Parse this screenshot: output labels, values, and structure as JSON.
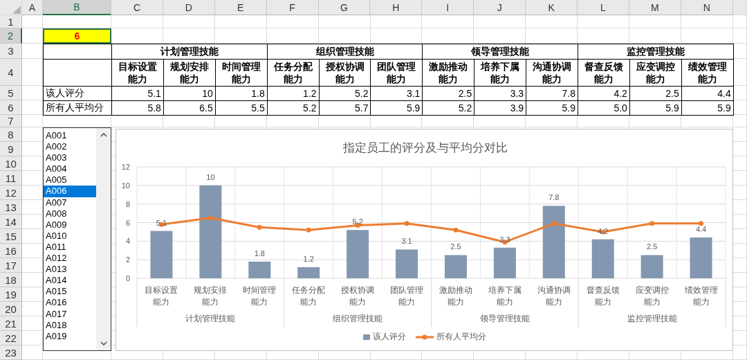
{
  "column_headers": [
    {
      "label": "A",
      "selected": false
    },
    {
      "label": "B",
      "selected": true
    },
    {
      "label": "C",
      "selected": false
    },
    {
      "label": "D",
      "selected": false
    },
    {
      "label": "E",
      "selected": false
    },
    {
      "label": "F",
      "selected": false
    },
    {
      "label": "G",
      "selected": false
    },
    {
      "label": "H",
      "selected": false
    },
    {
      "label": "I",
      "selected": false
    },
    {
      "label": "J",
      "selected": false
    },
    {
      "label": "K",
      "selected": false
    },
    {
      "label": "L",
      "selected": false
    },
    {
      "label": "M",
      "selected": false
    },
    {
      "label": "N",
      "selected": false
    }
  ],
  "row_headers": [
    {
      "label": "1",
      "selected": false
    },
    {
      "label": "2",
      "selected": true
    },
    {
      "label": "3",
      "selected": false
    },
    {
      "label": "4",
      "selected": false
    },
    {
      "label": "5",
      "selected": false
    },
    {
      "label": "6",
      "selected": false
    },
    {
      "label": "7",
      "selected": false
    },
    {
      "label": "8",
      "selected": false
    },
    {
      "label": "9",
      "selected": false
    },
    {
      "label": "10",
      "selected": false
    },
    {
      "label": "11",
      "selected": false
    },
    {
      "label": "12",
      "selected": false
    },
    {
      "label": "13",
      "selected": false
    },
    {
      "label": "14",
      "selected": false
    },
    {
      "label": "15",
      "selected": false
    },
    {
      "label": "16",
      "selected": false
    },
    {
      "label": "17",
      "selected": false
    },
    {
      "label": "18",
      "selected": false
    },
    {
      "label": "19",
      "selected": false
    },
    {
      "label": "20",
      "selected": false
    },
    {
      "label": "21",
      "selected": false
    },
    {
      "label": "22",
      "selected": false
    },
    {
      "label": "23",
      "selected": false
    }
  ],
  "selector_cell": {
    "value": "6"
  },
  "table": {
    "groups": [
      {
        "label": "计划管理技能",
        "columns": [
          "目标设置能力",
          "规划安排能力",
          "时间管理能力"
        ]
      },
      {
        "label": "组织管理技能",
        "columns": [
          "任务分配能力",
          "授权协调能力",
          "团队管理能力"
        ]
      },
      {
        "label": "领导管理技能",
        "columns": [
          "激励推动能力",
          "培养下属能力",
          "沟通协调能力"
        ]
      },
      {
        "label": "监控管理技能",
        "columns": [
          "督查反馈能力",
          "应变调控能力",
          "绩效管理能力"
        ]
      }
    ],
    "rows": [
      {
        "label": "该人评分",
        "values": [
          "5.1",
          "10",
          "1.8",
          "1.2",
          "5.2",
          "3.1",
          "2.5",
          "3.3",
          "7.8",
          "4.2",
          "2.5",
          "4.4"
        ]
      },
      {
        "label": "所有人平均分",
        "values": [
          "5.8",
          "6.5",
          "5.5",
          "5.2",
          "5.7",
          "5.9",
          "5.2",
          "3.9",
          "5.9",
          "5.0",
          "5.9",
          "5.9"
        ]
      }
    ]
  },
  "employee_list": {
    "items": [
      {
        "label": "A001",
        "selected": false
      },
      {
        "label": "A002",
        "selected": false
      },
      {
        "label": "A003",
        "selected": false
      },
      {
        "label": "A004",
        "selected": false
      },
      {
        "label": "A005",
        "selected": false
      },
      {
        "label": "A006",
        "selected": true
      },
      {
        "label": "A007",
        "selected": false
      },
      {
        "label": "A008",
        "selected": false
      },
      {
        "label": "A009",
        "selected": false
      },
      {
        "label": "A010",
        "selected": false
      },
      {
        "label": "A011",
        "selected": false
      },
      {
        "label": "A012",
        "selected": false
      },
      {
        "label": "A013",
        "selected": false
      },
      {
        "label": "A014",
        "selected": false
      },
      {
        "label": "A015",
        "selected": false
      },
      {
        "label": "A016",
        "selected": false
      },
      {
        "label": "A017",
        "selected": false
      },
      {
        "label": "A018",
        "selected": false
      },
      {
        "label": "A019",
        "selected": false
      }
    ]
  },
  "chart": {
    "category_groups": [
      "计划管理技能",
      "组织管理技能",
      "领导管理技能",
      "监控管理技能"
    ],
    "chart_data": {
      "type": "bar",
      "title": "指定员工的评分及与平均分对比",
      "categories": [
        "目标设置能力",
        "规划安排能力",
        "时间管理能力",
        "任务分配能力",
        "授权协调能力",
        "团队管理能力",
        "激励推动能力",
        "培养下属能力",
        "沟通协调能力",
        "督查反馈能力",
        "应变调控能力",
        "绩效管理能力"
      ],
      "ylim": [
        0,
        12
      ],
      "yticks": [
        0,
        2,
        4,
        6,
        8,
        10,
        12
      ],
      "grid": true,
      "legend": "bottom",
      "series": [
        {
          "name": "该人评分",
          "color": "#8497b0",
          "values": [
            5.1,
            10,
            1.8,
            1.2,
            5.2,
            3.1,
            2.5,
            3.3,
            7.8,
            4.2,
            2.5,
            4.4
          ],
          "value_labels": [
            "5.1",
            "10",
            "1.8",
            "1.2",
            "5.2",
            "3.1",
            "2.5",
            "3.3",
            "7.8",
            "4.2",
            "2.5",
            "4.4"
          ]
        },
        {
          "name": "所有人平均分",
          "type": "line",
          "marker": "circle",
          "color": "#ed7d31",
          "values": [
            5.8,
            6.5,
            5.5,
            5.2,
            5.7,
            5.9,
            5.2,
            3.9,
            5.9,
            5.0,
            5.9,
            5.9
          ]
        }
      ]
    }
  }
}
